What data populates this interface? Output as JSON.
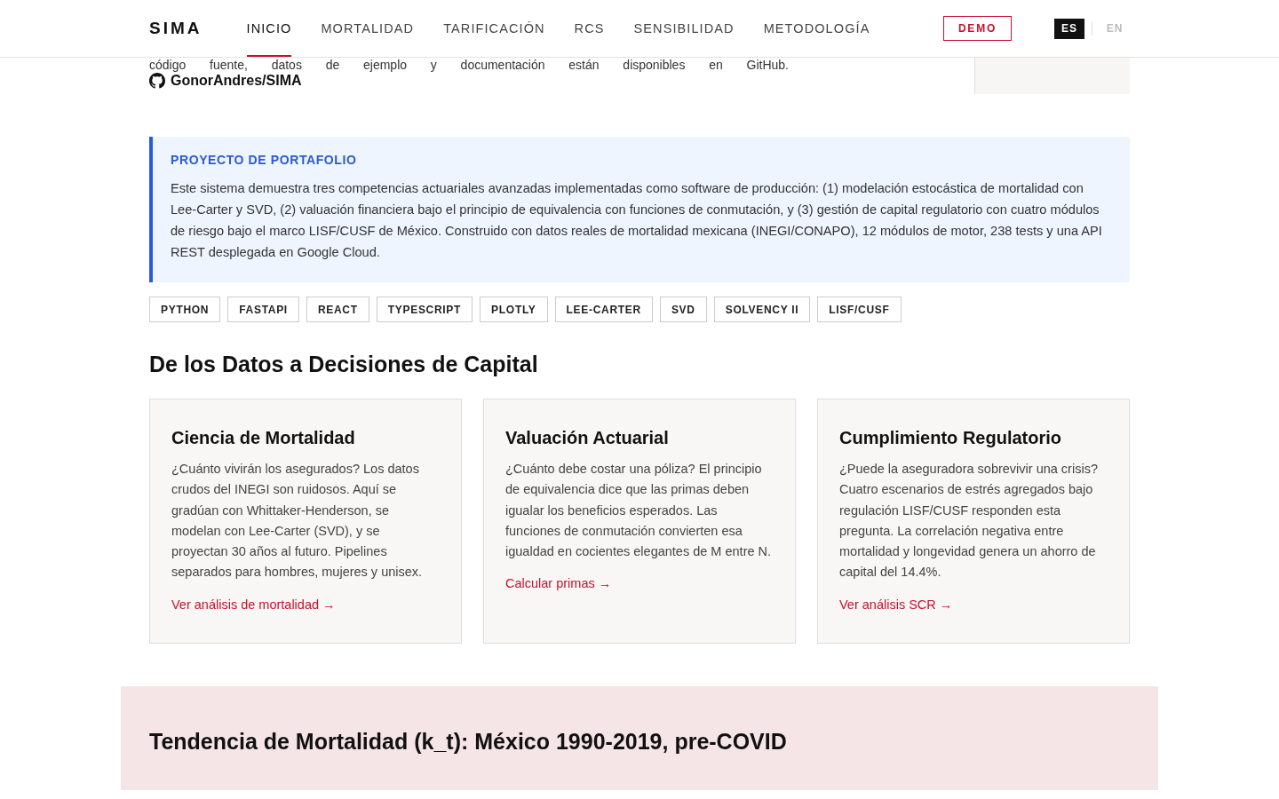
{
  "header": {
    "logo": "SIMA",
    "nav": [
      {
        "label": "INICIO",
        "selected": true
      },
      {
        "label": "MORTALIDAD",
        "selected": false
      },
      {
        "label": "TARIFICACIÓN",
        "selected": false
      },
      {
        "label": "RCS",
        "selected": false
      },
      {
        "label": "SENSIBILIDAD",
        "selected": false
      },
      {
        "label": "METODOLOGÍA",
        "selected": false
      }
    ],
    "demo_button": "DEMO",
    "languages": [
      {
        "label": "ES",
        "selected": true
      },
      {
        "label": "EN",
        "selected": false
      }
    ]
  },
  "intro": {
    "cut_line": "código fuente, datos de ejemplo y documentación están disponibles en GitHub.",
    "github_link": "GonorAndres/SIMA"
  },
  "callout": {
    "title": "PROYECTO DE PORTAFOLIO",
    "text": "Este sistema demuestra tres competencias actuariales avanzadas implementadas como software de producción: (1) modelación estocástica de mortalidad con Lee-Carter y SVD, (2) valuación financiera bajo el principio de equivalencia con funciones de conmutación, y (3) gestión de capital regulatorio con cuatro módulos de riesgo bajo el marco LISF/CUSF de México. Construido con datos reales de mortalidad mexicana (INEGI/CONAPO), 12 módulos de motor, 238 tests y una API REST desplegada en Google Cloud."
  },
  "tags": [
    "PYTHON",
    "FASTAPI",
    "REACT",
    "TYPESCRIPT",
    "PLOTLY",
    "LEE-CARTER",
    "SVD",
    "SOLVENCY II",
    "LISF/CUSF"
  ],
  "section_title": "De los Datos a Decisiones de Capital",
  "cards": [
    {
      "title": "Ciencia de Mortalidad",
      "text": "¿Cuánto vivirán los asegurados? Los datos crudos del INEGI son ruidosos. Aquí se gradúan con Whittaker-Henderson, se modelan con Lee-Carter (SVD), y se proyectan 30 años al futuro. Pipelines separados para hombres, mujeres y unisex.",
      "link": "Ver análisis de mortalidad →"
    },
    {
      "title": "Valuación Actuarial",
      "text": "¿Cuánto debe costar una póliza? El principio de equivalencia dice que las primas deben igualar los beneficios esperados. Las funciones de conmutación convierten esa igualdad en cocientes elegantes de M entre N.",
      "link": "Calcular primas →"
    },
    {
      "title": "Cumplimiento Regulatorio",
      "text": "¿Puede la aseguradora sobrevivir una crisis? Cuatro escenarios de estrés agregados bajo regulación LISF/CUSF responden esta pregunta. La correlación negativa entre mortalidad y longevidad genera un ahorro de capital del 14.4%.",
      "link": "Ver análisis SCR →"
    }
  ],
  "trend_section": {
    "title": "Tendencia de Mortalidad (k_t): México 1990-2019, pre-COVID"
  }
}
